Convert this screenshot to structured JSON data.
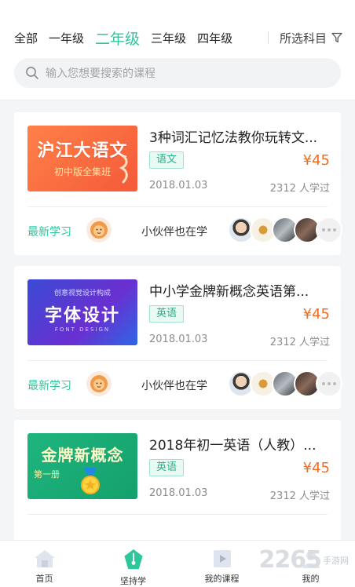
{
  "grade_tabs": [
    "全部",
    "一年级",
    "二年级",
    "三年级",
    "四年级"
  ],
  "active_grade": "二年级",
  "subject_filter": {
    "label": "所选科目",
    "icon": "filter-icon"
  },
  "search": {
    "placeholder": "输入您想要搜索的课程",
    "icon": "search-icon"
  },
  "courses": [
    {
      "title": "3种词汇记忆法教你玩转文...",
      "tag": "语文",
      "price": "¥45",
      "date": "2018.01.03",
      "learners": "2312 人学过",
      "thumb_line1": "沪江大语文",
      "thumb_line2": "初中版全集班",
      "latest_label": "最新学习",
      "peers_label": "小伙伴也在学"
    },
    {
      "title": "中小学金牌新概念英语第...",
      "tag": "英语",
      "price": "¥45",
      "date": "2018.01.03",
      "learners": "2312 人学过",
      "thumb_line0": "创意视觉设计构成",
      "thumb_line1": "字体设计",
      "thumb_line2": "FONT DESIGN",
      "latest_label": "最新学习",
      "peers_label": "小伙伴也在学"
    },
    {
      "title": "2018年初一英语（人教）...",
      "tag": "英语",
      "price": "¥45",
      "date": "2018.01.03",
      "learners": "2312 人学过",
      "thumb_line1": "金牌新概念",
      "thumb_line2": "第一册"
    }
  ],
  "tabbar": [
    {
      "label": "首页",
      "icon": "home-icon"
    },
    {
      "label": "坚持学",
      "icon": "pen-nib-icon"
    },
    {
      "label": "我的课程",
      "icon": "course-play-icon"
    },
    {
      "label": "我的",
      "icon": "profile-icon"
    }
  ],
  "watermark": {
    "number": "2265",
    "site": "手游网"
  },
  "colors": {
    "accent": "#2ec79d",
    "price": "#f36c21"
  }
}
